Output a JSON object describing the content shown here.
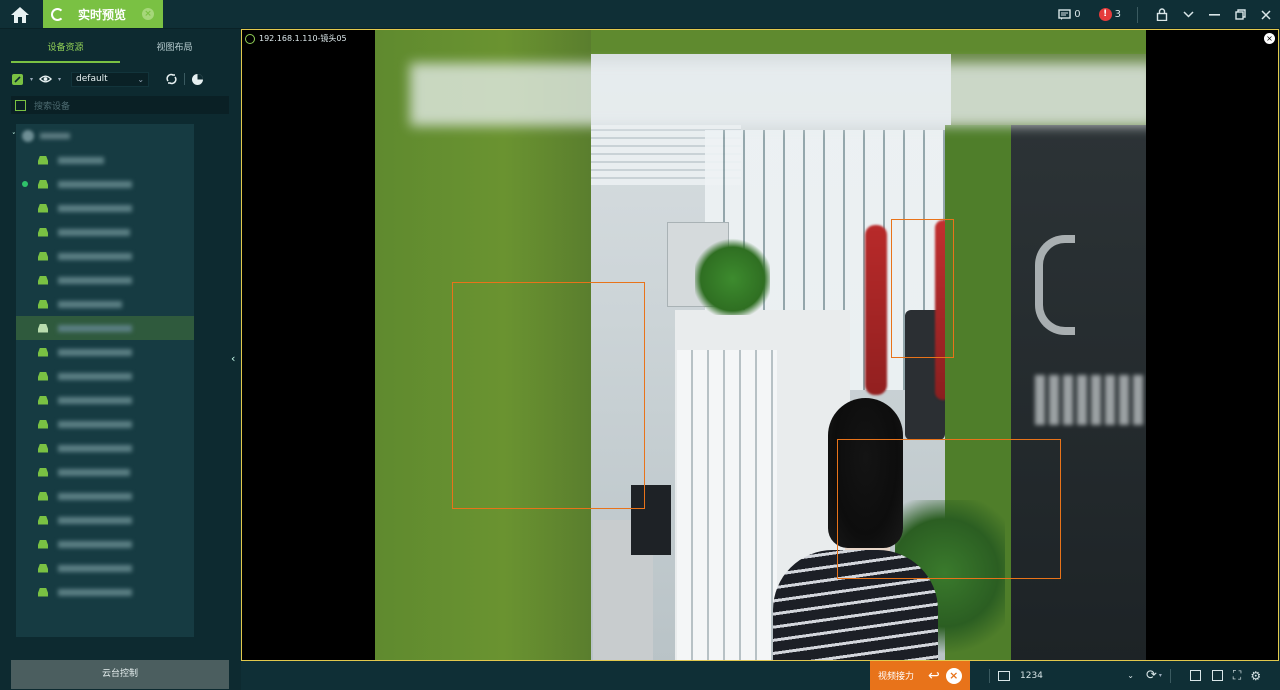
{
  "top": {
    "active_tab_label": "实时预览",
    "message_count": "0",
    "alarm_count": "3"
  },
  "sidebar": {
    "tabs": [
      "设备资源",
      "视图布局"
    ],
    "group_select": "default",
    "search_placeholder": "搜索设备",
    "ptz_label": "云台控制"
  },
  "video": {
    "channel_title": "192.168.1.110-镜头05"
  },
  "bottom": {
    "talk_label": "视频接力",
    "layout_value": "1234"
  },
  "colors": {
    "accent": "#7ac143",
    "detection_box": "#e8731a",
    "active_frame": "#e2c94d",
    "alarm": "#e53b3b"
  }
}
